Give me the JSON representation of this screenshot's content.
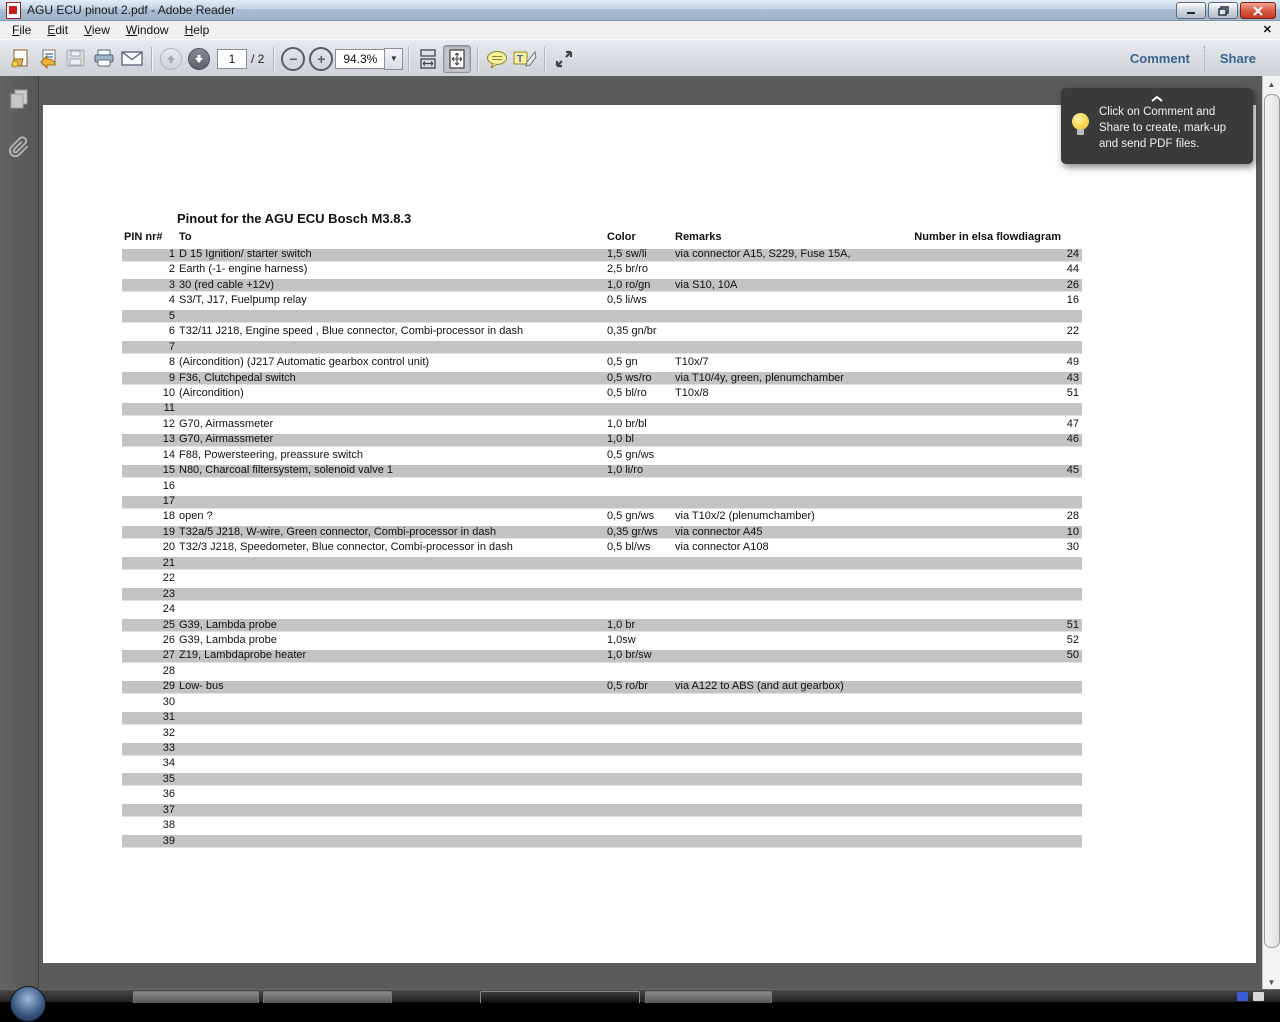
{
  "window": {
    "title": "AGU ECU pinout 2.pdf - Adobe Reader"
  },
  "menu": {
    "items": [
      "File",
      "Edit",
      "View",
      "Window",
      "Help"
    ]
  },
  "toolbar": {
    "page_current": "1",
    "page_total": "/ 2",
    "zoom_level": "94.3%",
    "comment_label": "Comment",
    "share_label": "Share"
  },
  "popup": {
    "line1": "Click on Comment and",
    "line2": "Share to create, mark-up",
    "line3": "and send PDF files."
  },
  "document": {
    "title": "Pinout for the AGU ECU Bosch M3.8.3",
    "headers": {
      "pin": "PIN nr#",
      "to": "To",
      "color": "Color",
      "remarks": "Remarks",
      "number": "Number in elsa flowdiagram"
    },
    "rows": [
      {
        "pin": "1",
        "to": "D 15 Ignition/ starter switch",
        "color": "1,5 sw/li",
        "remarks": "via connector A15, S229, Fuse 15A,",
        "number": "24"
      },
      {
        "pin": "2",
        "to": "Earth (-1- engine harness)",
        "color": "2,5 br/ro",
        "remarks": "",
        "number": "44"
      },
      {
        "pin": "3",
        "to": "30 (red cable +12v)",
        "color": "1,0 ro/gn",
        "remarks": "via S10, 10A",
        "number": "26"
      },
      {
        "pin": "4",
        "to": "S3/T, J17, Fuelpump relay",
        "color": "0,5 li/ws",
        "remarks": "",
        "number": "16"
      },
      {
        "pin": "5",
        "to": "",
        "color": "",
        "remarks": "",
        "number": ""
      },
      {
        "pin": "6",
        "to": "T32/11 J218, Engine speed , Blue connector, Combi-processor in dash",
        "color": "0,35 gn/br",
        "remarks": "",
        "number": "22"
      },
      {
        "pin": "7",
        "to": "",
        "color": "",
        "remarks": "",
        "number": ""
      },
      {
        "pin": "8",
        "to": "(Aircondition) (J217 Automatic gearbox control unit)",
        "color": "0,5 gn",
        "remarks": "T10x/7",
        "number": "49"
      },
      {
        "pin": "9",
        "to": "F36, Clutchpedal switch",
        "color": "0,5 ws/ro",
        "remarks": "via T10/4y, green, plenumchamber",
        "number": "43"
      },
      {
        "pin": "10",
        "to": "(Aircondition)",
        "color": "0,5 bl/ro",
        "remarks": "T10x/8",
        "number": "51"
      },
      {
        "pin": "11",
        "to": "",
        "color": "",
        "remarks": "",
        "number": ""
      },
      {
        "pin": "12",
        "to": "G70, Airmassmeter",
        "color": "1,0 br/bl",
        "remarks": "",
        "number": "47"
      },
      {
        "pin": "13",
        "to": "G70, Airmassmeter",
        "color": "1,0 bl",
        "remarks": "",
        "number": "46"
      },
      {
        "pin": "14",
        "to": "F88, Powersteering, preassure switch",
        "color": "0,5 gn/ws",
        "remarks": "",
        "number": ""
      },
      {
        "pin": "15",
        "to": "N80, Charcoal filtersystem, solenoid valve 1",
        "color": "1,0 li/ro",
        "remarks": "",
        "number": "45"
      },
      {
        "pin": "16",
        "to": "",
        "color": "",
        "remarks": "",
        "number": ""
      },
      {
        "pin": "17",
        "to": "",
        "color": "",
        "remarks": "",
        "number": ""
      },
      {
        "pin": "18",
        "to": "open ?",
        "color": "0,5 gn/ws",
        "remarks": "via T10x/2 (plenumchamber)",
        "number": "28"
      },
      {
        "pin": "19",
        "to": "T32a/5 J218, W-wire, Green connector, Combi-processor in dash",
        "color": "0,35 gr/ws",
        "remarks": "via connector A45",
        "number": "10"
      },
      {
        "pin": "20",
        "to": "T32/3 J218, Speedometer, Blue connector, Combi-processor in dash",
        "color": "0,5 bl/ws",
        "remarks": "via connector A108",
        "number": "30"
      },
      {
        "pin": "21",
        "to": "",
        "color": "",
        "remarks": "",
        "number": ""
      },
      {
        "pin": "22",
        "to": "",
        "color": "",
        "remarks": "",
        "number": ""
      },
      {
        "pin": "23",
        "to": "",
        "color": "",
        "remarks": "",
        "number": ""
      },
      {
        "pin": "24",
        "to": "",
        "color": "",
        "remarks": "",
        "number": ""
      },
      {
        "pin": "25",
        "to": "G39, Lambda probe",
        "color": "1,0 br",
        "remarks": "",
        "number": "51"
      },
      {
        "pin": "26",
        "to": "G39, Lambda probe",
        "color": "1,0sw",
        "remarks": "",
        "number": "52"
      },
      {
        "pin": "27",
        "to": "Z19, Lambdaprobe heater",
        "color": "1,0 br/sw",
        "remarks": "",
        "number": "50"
      },
      {
        "pin": "28",
        "to": "",
        "color": "",
        "remarks": "",
        "number": ""
      },
      {
        "pin": "29",
        "to": "Low- bus",
        "color": "0,5 ro/br",
        "remarks": "via A122 to ABS (and aut gearbox)",
        "number": ""
      },
      {
        "pin": "30",
        "to": "",
        "color": "",
        "remarks": "",
        "number": ""
      },
      {
        "pin": "31",
        "to": "",
        "color": "",
        "remarks": "",
        "number": ""
      },
      {
        "pin": "32",
        "to": "",
        "color": "",
        "remarks": "",
        "number": ""
      },
      {
        "pin": "33",
        "to": "",
        "color": "",
        "remarks": "",
        "number": ""
      },
      {
        "pin": "34",
        "to": "",
        "color": "",
        "remarks": "",
        "number": ""
      },
      {
        "pin": "35",
        "to": "",
        "color": "",
        "remarks": "",
        "number": ""
      },
      {
        "pin": "36",
        "to": "",
        "color": "",
        "remarks": "",
        "number": ""
      },
      {
        "pin": "37",
        "to": "",
        "color": "",
        "remarks": "",
        "number": ""
      },
      {
        "pin": "38",
        "to": "",
        "color": "",
        "remarks": "",
        "number": ""
      },
      {
        "pin": "39",
        "to": "",
        "color": "",
        "remarks": "",
        "number": ""
      }
    ],
    "colors": {
      "row_shade": "#c3c3c3",
      "page_bg": "#ffffff",
      "canvas_bg": "#5b5b5b"
    }
  }
}
